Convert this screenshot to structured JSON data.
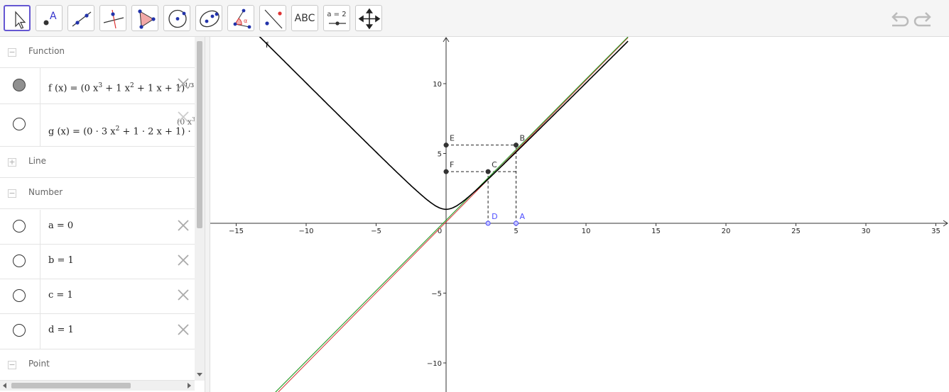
{
  "toolbar": {
    "tools": [
      {
        "name": "move-tool",
        "text": ""
      },
      {
        "name": "point-tool",
        "text": ""
      },
      {
        "name": "line-tool",
        "text": ""
      },
      {
        "name": "perpendicular-line-tool",
        "text": ""
      },
      {
        "name": "polygon-tool",
        "text": ""
      },
      {
        "name": "circle-tool",
        "text": ""
      },
      {
        "name": "conic-tool",
        "text": ""
      },
      {
        "name": "angle-tool",
        "text": ""
      },
      {
        "name": "reflect-tool",
        "text": ""
      },
      {
        "name": "text-tool",
        "text": "ABC"
      },
      {
        "name": "slider-tool",
        "text": "a = 2"
      },
      {
        "name": "move-graphics-view-tool",
        "text": ""
      }
    ],
    "undo_icon": "undo-icon",
    "redo_icon": "redo-icon"
  },
  "algebra": {
    "categories": {
      "function": {
        "label": "Function",
        "toggle": "−"
      },
      "line": {
        "label": "Line",
        "toggle": "+"
      },
      "number": {
        "label": "Number",
        "toggle": "−"
      },
      "point": {
        "label": "Point",
        "toggle": "−"
      }
    },
    "functions": [
      {
        "name": "f",
        "lhs": "f (x)  =  ",
        "base": "(0 x",
        "e1": "3",
        "m1": " + 1 x",
        "e2": "2",
        "m2": " + 1 x + 1)",
        "outer_exp": "1/3",
        "visible": true
      },
      {
        "name": "g",
        "lhs": "g (x)  =  ",
        "base": "(0 · 3 x",
        "e1": "2",
        "m1": " + 1 · 2 x + 1) · ",
        "frac_num": "(0 x",
        "frac_num_exp": "3",
        "visible": false
      }
    ],
    "numbers": [
      {
        "text": "a = 0"
      },
      {
        "text": "b = 1"
      },
      {
        "text": "c = 1"
      },
      {
        "text": "d = 1"
      }
    ]
  },
  "graph": {
    "x_ticks": [
      "−15",
      "−10",
      "−5",
      "0",
      "5",
      "10",
      "15",
      "20",
      "25",
      "30",
      "35"
    ],
    "y_ticks": [
      "10",
      "5",
      "−5",
      "−10"
    ],
    "function_label": "f",
    "points": [
      {
        "name": "A",
        "x": 5,
        "y": 0,
        "color": "#4d4dff",
        "style": "open"
      },
      {
        "name": "B",
        "x": 5,
        "y": 5.6,
        "color": "#333333",
        "style": "filled"
      },
      {
        "name": "C",
        "x": 3,
        "y": 3.7,
        "color": "#333333",
        "style": "filled"
      },
      {
        "name": "D",
        "x": 3,
        "y": 0,
        "color": "#4d4dff",
        "style": "open"
      },
      {
        "name": "E",
        "x": 0,
        "y": 5.6,
        "color": "#333333",
        "style": "filled"
      },
      {
        "name": "F",
        "x": 0,
        "y": 3.7,
        "color": "#333333",
        "style": "filled"
      }
    ],
    "colors": {
      "function": "#000000",
      "tangent_green": "#2e9e2e",
      "tangent_red": "#d33333",
      "axis": "#333333",
      "toolbar_active": "#6557d2"
    }
  }
}
